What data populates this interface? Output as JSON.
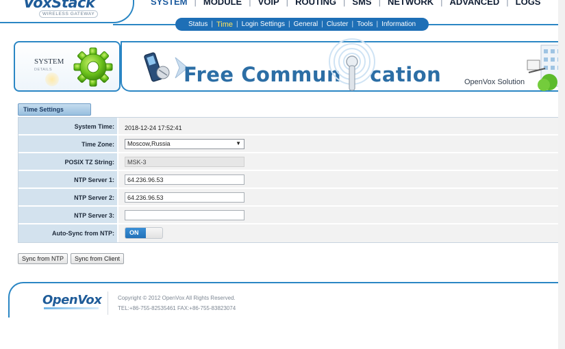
{
  "app": {
    "logo": "VoxStack",
    "logo_sub": "WIRELESS GATEWAY"
  },
  "main_nav": [
    {
      "label": "SYSTEM",
      "active": true
    },
    {
      "label": "MODULE",
      "active": false
    },
    {
      "label": "VOIP",
      "active": false
    },
    {
      "label": "ROUTING",
      "active": false
    },
    {
      "label": "SMS",
      "active": false
    },
    {
      "label": "NETWORK",
      "active": false
    },
    {
      "label": "ADVANCED",
      "active": false
    },
    {
      "label": "LOGS",
      "active": false
    }
  ],
  "sub_nav": [
    {
      "label": "Status",
      "active": false
    },
    {
      "label": "Time",
      "active": true
    },
    {
      "label": "Login Settings",
      "active": false
    },
    {
      "label": "General",
      "active": false
    },
    {
      "label": "Cluster",
      "active": false
    },
    {
      "label": "Tools",
      "active": false
    },
    {
      "label": "Information",
      "active": false
    }
  ],
  "banner": {
    "section_title": "SYSTEM",
    "section_sub": "DETAILS",
    "slogan_part1": "Free Commun",
    "slogan_part2": "cation",
    "company": "OpenVox Solution"
  },
  "time_settings": {
    "tab_label": "Time Settings",
    "system_time": {
      "label": "System Time:",
      "value": "2018-12-24 17:52:41"
    },
    "time_zone": {
      "label": "Time Zone:",
      "value": "Moscow,Russia"
    },
    "posix_tz": {
      "label": "POSIX TZ String:",
      "value": "MSK-3"
    },
    "ntp1": {
      "label": "NTP Server 1:",
      "value": "64.236.96.53"
    },
    "ntp2": {
      "label": "NTP Server 2:",
      "value": "64.236.96.53"
    },
    "ntp3": {
      "label": "NTP Server 3:",
      "value": ""
    },
    "auto_sync": {
      "label": "Auto-Sync from NTP:",
      "state": "ON"
    }
  },
  "buttons": {
    "sync_ntp": "Sync from NTP",
    "sync_client": "Sync from Client"
  },
  "footer": {
    "logo": "OpenVox",
    "copyright": "Copyright © 2012 OpenVox All Rights Reserved.",
    "contact": "TEL:+86-755-82535461 FAX:+86-755-83823074"
  },
  "colors": {
    "accent": "#2a86c4",
    "nav_bar": "#1e6fb6",
    "active_sub": "#ffe45c",
    "label_bg": "#d3e2ee",
    "toggle_on": "#2271b8"
  }
}
